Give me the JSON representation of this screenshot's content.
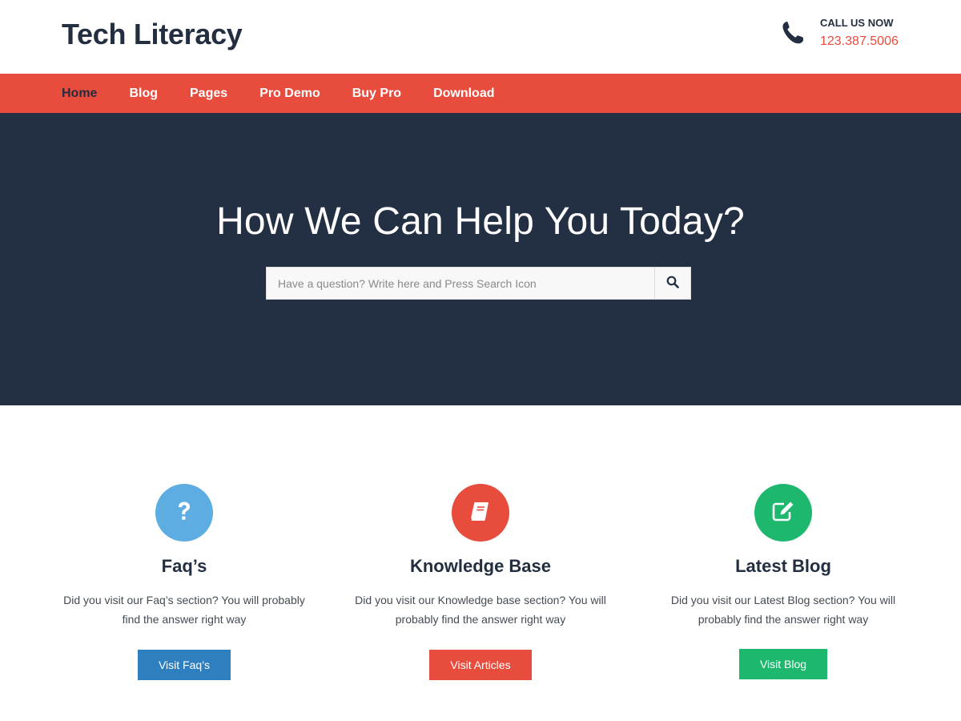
{
  "header": {
    "site_title": "Tech Literacy",
    "call_label": "CALL US NOW",
    "call_number": "123.387.5006",
    "icon": "phone-icon"
  },
  "nav": {
    "items": [
      {
        "label": "Home",
        "active": true
      },
      {
        "label": "Blog",
        "active": false
      },
      {
        "label": "Pages",
        "active": false
      },
      {
        "label": "Pro Demo",
        "active": false
      },
      {
        "label": "Buy Pro",
        "active": false
      },
      {
        "label": "Download",
        "active": false
      }
    ]
  },
  "hero": {
    "title": "How We Can Help You Today?",
    "search_placeholder": "Have a question? Write here and Press Search Icon",
    "search_value": "",
    "search_icon": "search-icon"
  },
  "features": [
    {
      "icon": "question-icon",
      "color": "#5dade2",
      "title": "Faq’s",
      "text": "Did you visit our Faq’s section? You will probably find the answer right way",
      "button_label": "Visit Faq’s",
      "button_color": "#2e7fbf"
    },
    {
      "icon": "book-icon",
      "color": "#e84c3d",
      "title": "Knowledge Base",
      "text": "Did you visit our Knowledge base section? You will probably find the answer right way",
      "button_label": "Visit Articles",
      "button_color": "#e84c3d"
    },
    {
      "icon": "edit-icon",
      "color": "#1db86e",
      "title": "Latest Blog",
      "text": "Did you visit our Latest Blog section? You will probably find the answer right way",
      "button_label": "Visit Blog",
      "button_color": "#1db86e"
    }
  ],
  "colors": {
    "brand_dark": "#232f40",
    "accent_red": "#e84c3d",
    "hero_bg": "#232f42"
  }
}
